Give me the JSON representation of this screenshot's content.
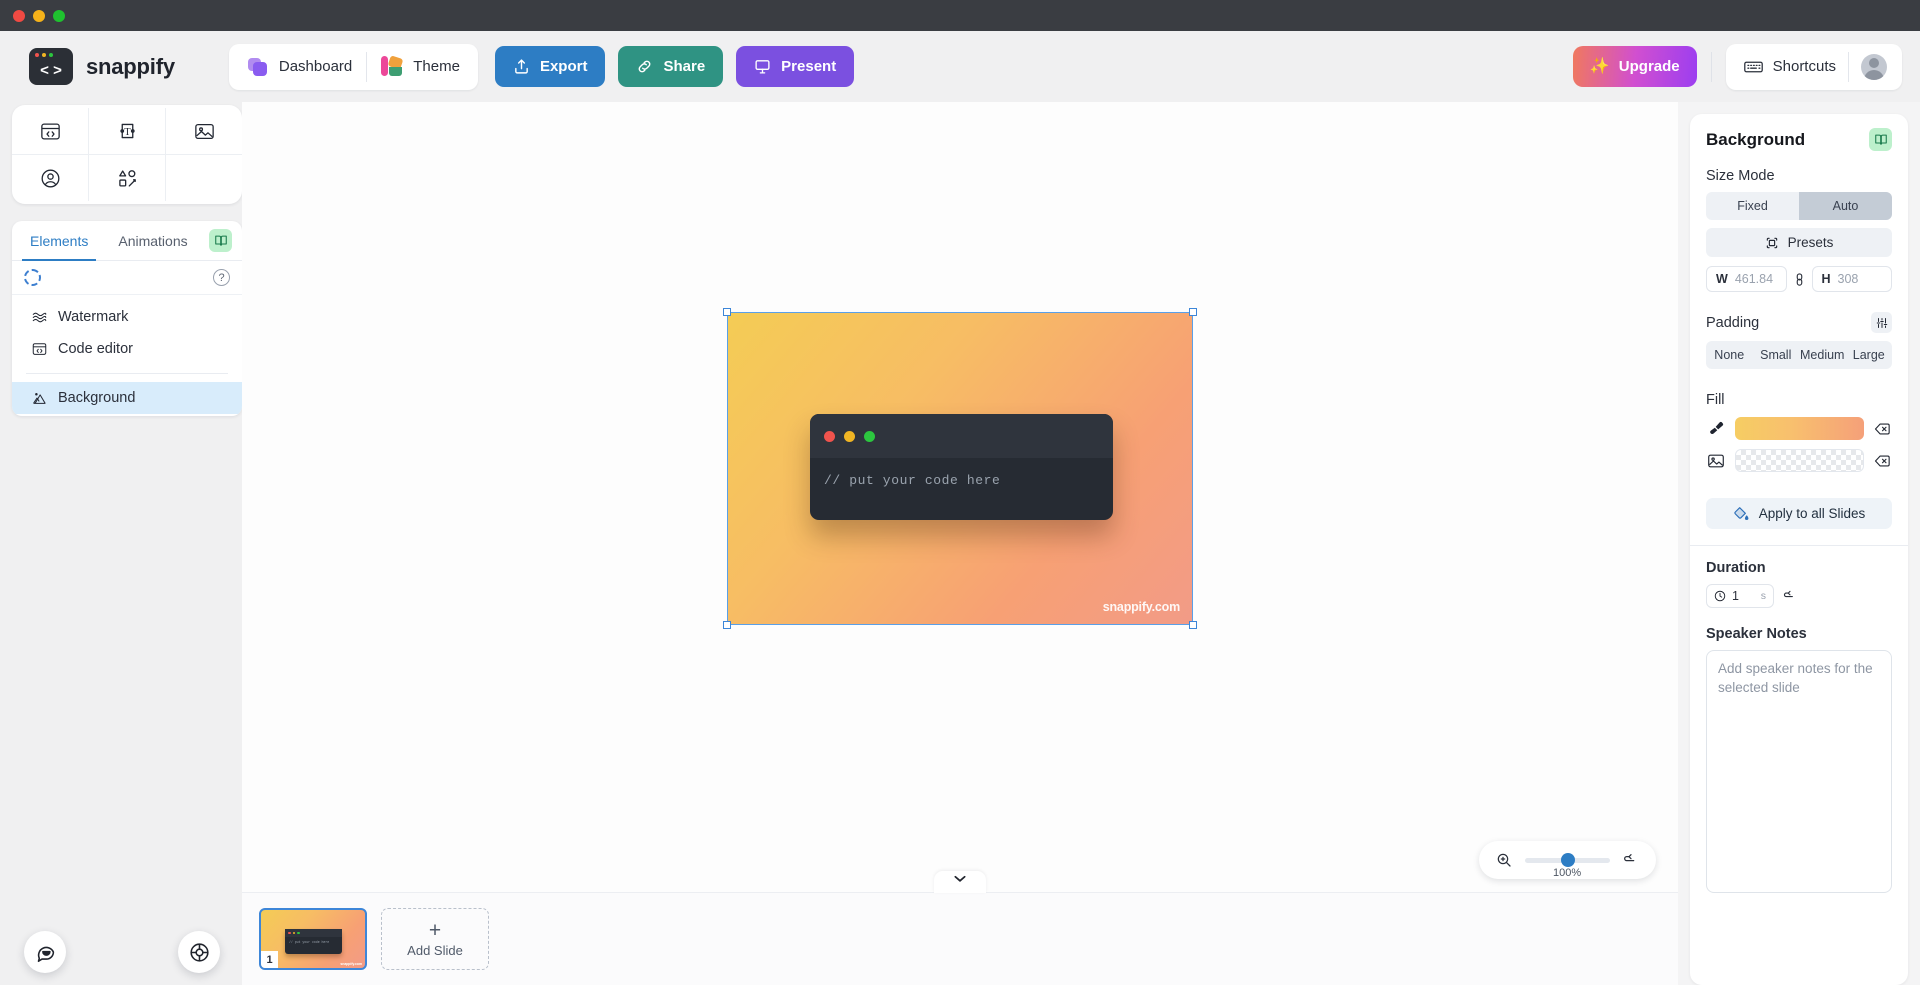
{
  "window": {
    "dots": [
      "#f04a43",
      "#f5b21a",
      "#1fc22f"
    ]
  },
  "brand": {
    "name": "snappify",
    "logo_glyph": "< >"
  },
  "header": {
    "nav": [
      {
        "label": "Dashboard",
        "icon": "dashboard-icon"
      },
      {
        "label": "Theme",
        "icon": "theme-palette-icon"
      }
    ],
    "actions": [
      {
        "label": "Export",
        "icon": "upload-icon",
        "color": "#2d7dc4"
      },
      {
        "label": "Share",
        "icon": "link-icon",
        "color": "#2f9383"
      },
      {
        "label": "Present",
        "icon": "presentation-icon",
        "color": "#7b50e0"
      }
    ],
    "upgrade_label": "Upgrade",
    "shortcuts_label": "Shortcuts"
  },
  "left_panel": {
    "tools": [
      {
        "name": "code-window-tool",
        "icon": "code-window-icon"
      },
      {
        "name": "text-tool",
        "icon": "text-icon"
      },
      {
        "name": "image-tool",
        "icon": "image-icon"
      },
      {
        "name": "avatar-tool",
        "icon": "user-circle-icon"
      },
      {
        "name": "shapes-tool",
        "icon": "shapes-icon"
      }
    ],
    "tabs": [
      {
        "label": "Elements",
        "active": true
      },
      {
        "label": "Animations",
        "active": false
      }
    ],
    "help_glyph": "?",
    "items": [
      {
        "label": "Watermark",
        "icon": "watermark-icon",
        "selected": false
      },
      {
        "label": "Code editor",
        "icon": "code-window-icon",
        "selected": false
      },
      {
        "label": "Background",
        "icon": "background-icon",
        "selected": true
      }
    ]
  },
  "canvas": {
    "code_text": "// put your code here",
    "watermark": "snappify.com",
    "traffic_lights": [
      "#f0534d",
      "#f0b524",
      "#2cc63f"
    ],
    "zoom": {
      "value": "100%",
      "icon": "zoom-in-icon",
      "reset_icon": "reset-icon"
    }
  },
  "slides_bar": {
    "thumb_number": "1",
    "thumb_code_text": "// put your code here",
    "thumb_watermark": "snappify.com",
    "add_slide_label": "Add Slide",
    "add_slide_plus": "+"
  },
  "fabs": [
    {
      "name": "chat-bubble-icon"
    },
    {
      "name": "help-lifebuoy-icon"
    }
  ],
  "right_panel": {
    "title": "Background",
    "size_mode_label": "Size Mode",
    "size_mode_options": [
      {
        "label": "Fixed",
        "active": false
      },
      {
        "label": "Auto",
        "active": true
      }
    ],
    "presets_label": "Presets",
    "dimensions": {
      "width_key": "W",
      "width_value": "461.84",
      "height_key": "H",
      "height_value": "308"
    },
    "padding_label": "Padding",
    "padding_options": [
      {
        "label": "None"
      },
      {
        "label": "Small"
      },
      {
        "label": "Medium"
      },
      {
        "label": "Large"
      }
    ],
    "fill_label": "Fill",
    "fill_gradient_from": "#f6cd63",
    "fill_gradient_to": "#f5a079",
    "apply_all_label": "Apply to all Slides",
    "duration_label": "Duration",
    "duration_value": "1",
    "duration_unit": "s",
    "notes_label": "Speaker Notes",
    "notes_placeholder": "Add speaker notes for the selected slide"
  }
}
